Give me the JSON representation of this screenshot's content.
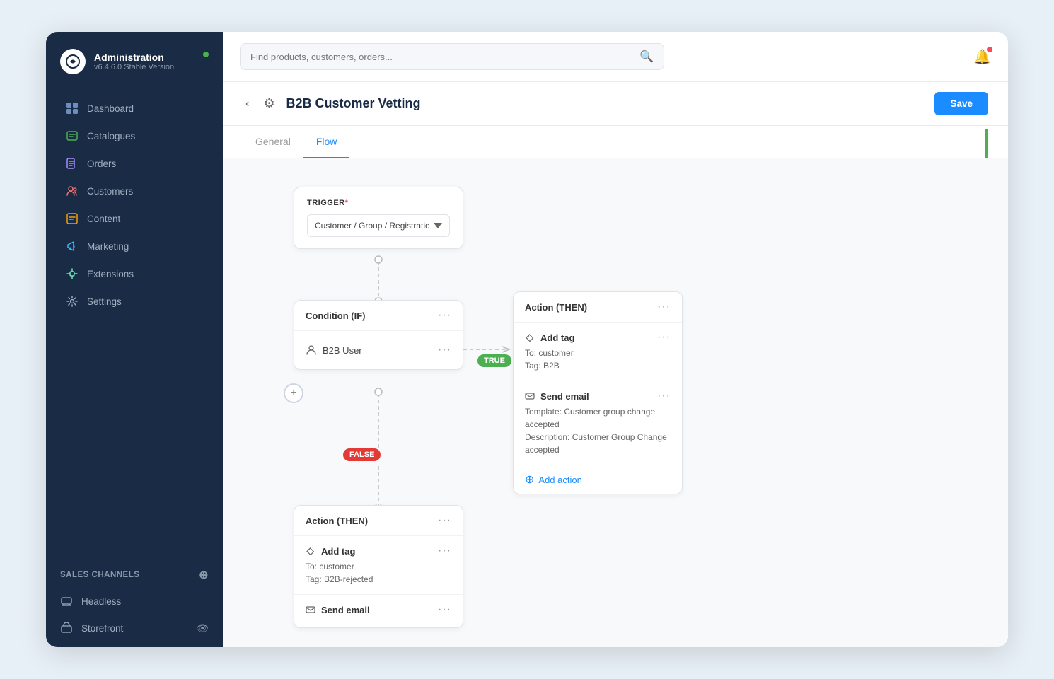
{
  "app": {
    "title": "Administration",
    "version": "v6.4.6.0 Stable Version",
    "status_dot_color": "#4caf50"
  },
  "sidebar": {
    "nav_items": [
      {
        "id": "dashboard",
        "label": "Dashboard",
        "icon": "dashboard-icon"
      },
      {
        "id": "catalogues",
        "label": "Catalogues",
        "icon": "catalogues-icon"
      },
      {
        "id": "orders",
        "label": "Orders",
        "icon": "orders-icon"
      },
      {
        "id": "customers",
        "label": "Customers",
        "icon": "customers-icon"
      },
      {
        "id": "content",
        "label": "Content",
        "icon": "content-icon"
      },
      {
        "id": "marketing",
        "label": "Marketing",
        "icon": "marketing-icon"
      },
      {
        "id": "extensions",
        "label": "Extensions",
        "icon": "extensions-icon"
      },
      {
        "id": "settings",
        "label": "Settings",
        "icon": "settings-icon"
      }
    ],
    "sales_channels_label": "Sales Channels",
    "channels": [
      {
        "id": "headless",
        "label": "Headless",
        "icon": "headless-icon"
      },
      {
        "id": "storefront",
        "label": "Storefront",
        "icon": "storefront-icon"
      }
    ]
  },
  "topbar": {
    "search_placeholder": "Find products, customers, orders..."
  },
  "page": {
    "title": "B2B Customer Vetting",
    "save_label": "Save"
  },
  "tabs": [
    {
      "id": "general",
      "label": "General",
      "active": false
    },
    {
      "id": "flow",
      "label": "Flow",
      "active": true
    }
  ],
  "flow": {
    "trigger_label": "TRIGGER",
    "trigger_required": "*",
    "trigger_value": "Customer / Group / Registration / Acce...",
    "condition_label": "Condition (IF)",
    "condition_item": "B2B User",
    "badge_true": "TRUE",
    "badge_false": "FALSE",
    "action_then_label": "Action (THEN)",
    "action_right": {
      "items": [
        {
          "type": "add_tag",
          "title": "Add tag",
          "detail": "To: customer\nTag: B2B"
        },
        {
          "type": "send_email",
          "title": "Send email",
          "detail": "Template: Customer group change accepted\nDescription: Customer Group Change accepted"
        }
      ],
      "add_action_label": "Add action"
    },
    "action_bottom": {
      "items": [
        {
          "type": "add_tag",
          "title": "Add tag",
          "detail": "To: customer\nTag: B2B-rejected"
        },
        {
          "type": "send_email",
          "title": "Send email",
          "detail": ""
        }
      ]
    }
  }
}
